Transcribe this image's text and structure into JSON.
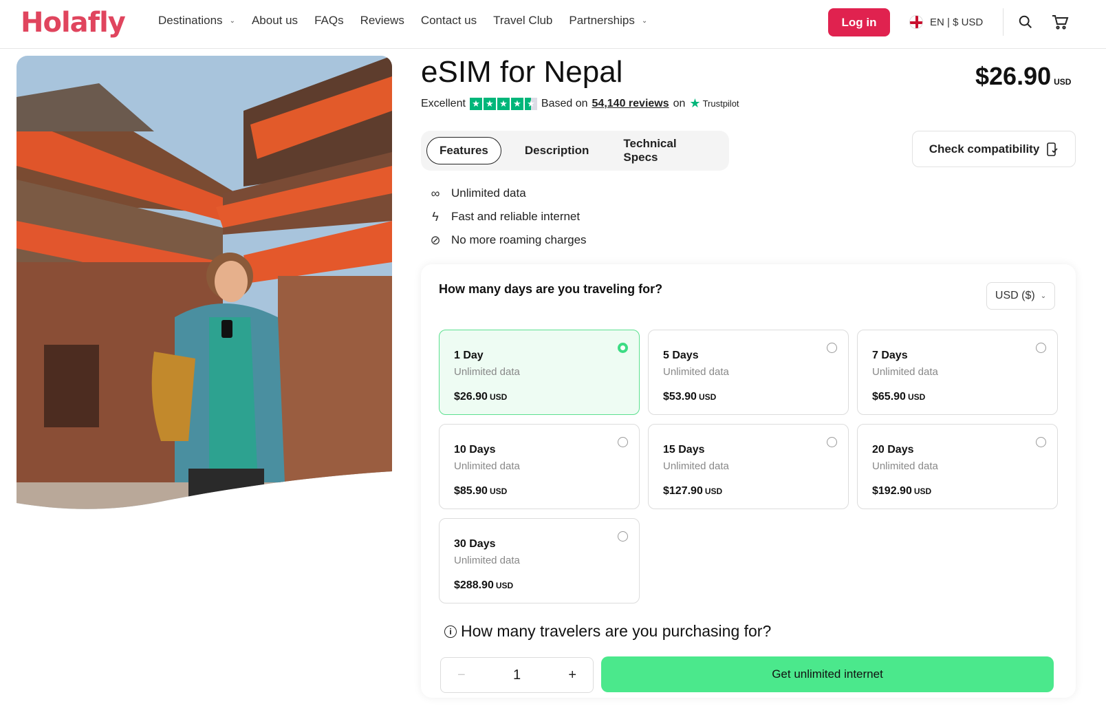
{
  "header": {
    "logo": "Holafly",
    "nav": [
      {
        "label": "Destinations",
        "dropdown": true
      },
      {
        "label": "About us",
        "dropdown": false
      },
      {
        "label": "FAQs",
        "dropdown": false
      },
      {
        "label": "Reviews",
        "dropdown": false
      },
      {
        "label": "Contact us",
        "dropdown": false
      },
      {
        "label": "Travel Club",
        "dropdown": false
      },
      {
        "label": "Partnerships",
        "dropdown": true
      }
    ],
    "login_label": "Log in",
    "language": "EN | $ USD",
    "icons": [
      "search-icon",
      "cart-icon"
    ]
  },
  "product": {
    "title": "eSIM for Nepal",
    "price": "$26.90",
    "currency": "USD",
    "rating": {
      "label": "Excellent",
      "based_on": "Based on",
      "count": "54,140 reviews",
      "on": "on",
      "provider": "Trustpilot",
      "stars": 4.5
    }
  },
  "tabs": [
    {
      "label": "Features",
      "active": true
    },
    {
      "label": "Description",
      "active": false
    },
    {
      "label": "Technical Specs",
      "active": false
    }
  ],
  "compatibility_label": "Check compatibility",
  "features": [
    {
      "icon": "infinity-icon",
      "glyph": "∞",
      "text": "Unlimited data"
    },
    {
      "icon": "lightning-icon",
      "glyph": "ϟ",
      "text": "Fast and reliable internet"
    },
    {
      "icon": "no-roaming-icon",
      "glyph": "⊘",
      "text": "No more roaming charges"
    }
  ],
  "plan_selector": {
    "question": "How many days are you traveling for?",
    "currency_select": "USD ($)",
    "plans": [
      {
        "days": "1 Day",
        "data": "Unlimited data",
        "price": "$26.90",
        "unit": "USD",
        "selected": true
      },
      {
        "days": "5 Days",
        "data": "Unlimited data",
        "price": "$53.90",
        "unit": "USD",
        "selected": false
      },
      {
        "days": "7 Days",
        "data": "Unlimited data",
        "price": "$65.90",
        "unit": "USD",
        "selected": false
      },
      {
        "days": "10 Days",
        "data": "Unlimited data",
        "price": "$85.90",
        "unit": "USD",
        "selected": false
      },
      {
        "days": "15 Days",
        "data": "Unlimited data",
        "price": "$127.90",
        "unit": "USD",
        "selected": false
      },
      {
        "days": "20 Days",
        "data": "Unlimited data",
        "price": "$192.90",
        "unit": "USD",
        "selected": false
      },
      {
        "days": "30 Days",
        "data": "Unlimited data",
        "price": "$288.90",
        "unit": "USD",
        "selected": false
      }
    ],
    "travelers_question": "How many travelers are you purchasing for?",
    "quantity": "1",
    "minus": "−",
    "plus": "+",
    "cta_label": "Get unlimited internet"
  },
  "colors": {
    "brand": "#e0455e",
    "login": "#e0224f",
    "cta": "#4be88c",
    "selected_border": "#5be08f",
    "trustpilot": "#00b67a"
  }
}
